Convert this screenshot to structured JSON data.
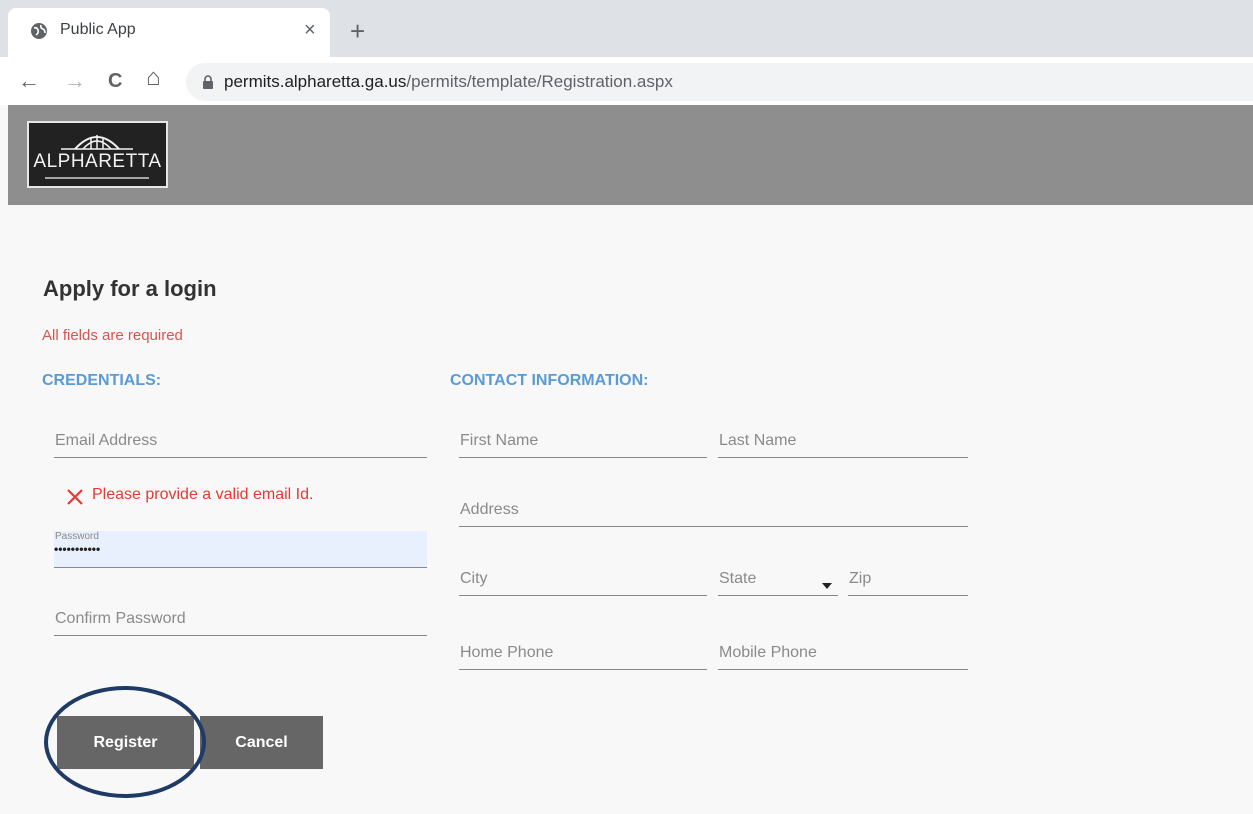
{
  "browser": {
    "tab_title": "Public App",
    "tab_close": "×",
    "new_tab": "+",
    "back": "←",
    "forward": "→",
    "reload": "C",
    "home": "⌂",
    "url_host": "permits.alpharetta.ga.us",
    "url_path": "/permits/template/Registration.aspx",
    "icons": {
      "favicon": "globe-icon",
      "lock": "lock-icon"
    }
  },
  "header": {
    "logo_text": "ALPHARETTA"
  },
  "form": {
    "heading": "Apply for a login",
    "required_note": "All fields are required",
    "credentials": {
      "title": "CREDENTIALS:",
      "email_placeholder": "Email Address",
      "email_error": "Please provide a valid email Id.",
      "password_label": "Password",
      "password_value": "•••••••••••",
      "confirm_password_placeholder": "Confirm Password"
    },
    "contact": {
      "title": "CONTACT INFORMATION:",
      "first_name": "First Name",
      "last_name": "Last Name",
      "address": "Address",
      "city": "City",
      "state": "State",
      "zip": "Zip",
      "home_phone": "Home Phone",
      "mobile_phone": "Mobile Phone"
    },
    "buttons": {
      "register": "Register",
      "cancel": "Cancel"
    }
  },
  "colors": {
    "banner": "#8e8e8e",
    "section_title": "#5b9bd5",
    "error": "#e53935",
    "required": "#d9534f",
    "button": "#666666",
    "highlight_ring": "#1f3a64"
  }
}
